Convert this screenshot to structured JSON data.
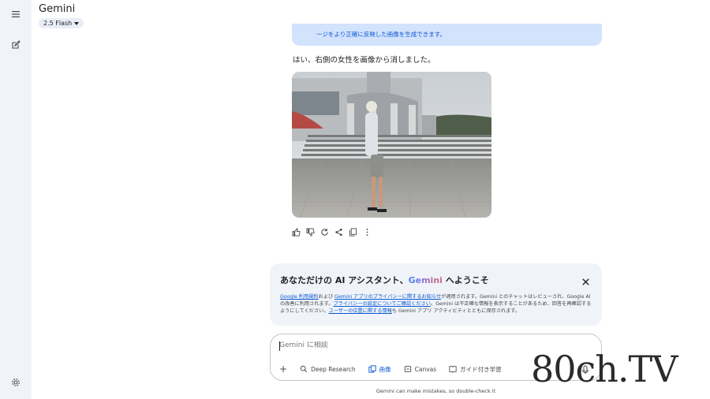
{
  "header": {
    "title": "Gemini",
    "model": "2.5 Flash"
  },
  "sidebar": {
    "menu_icon": "menu-icon",
    "new_chat_icon": "edit-icon",
    "settings_icon": "gear-icon"
  },
  "conversation": {
    "user_bubble_text": "ージをより正確に反映した画像を生成できます。",
    "reply_text": "はい、右側の女性を画像から消しました。",
    "action_icons": [
      "thumb-up-icon",
      "thumb-down-icon",
      "refresh-icon",
      "share-icon",
      "copy-icon",
      "more-icon"
    ]
  },
  "welcome": {
    "title_prefix": "あなただけの AI アシスタント、",
    "title_brand": "Gemini",
    "title_suffix": " へようこそ",
    "body": {
      "link1": "Google 利用規約",
      "t1": "および ",
      "link2": "Gemini アプリのプライバシーに関するお知らせ",
      "t2": "が適用されます。Gemini とのチャットはレビューされ、Google AI の改善に利用されます。",
      "link3": "プライバシーの設定についてご確認ください",
      "t3": "。Gemini は不正確な情報を表示することがあるため、回答を再確認するようにしてください。",
      "link4": "ユーザーの位置に関する情報",
      "t4": "も Gemini アプリ アクティビティとともに保存されます。"
    }
  },
  "composer": {
    "placeholder": "Gemini に相談",
    "tools": {
      "add": "+",
      "deep_research": "Deep Research",
      "image": "画像",
      "canvas": "Canvas",
      "guided": "ガイド付き学習"
    }
  },
  "disclaimer": "Gemini can make mistakes, so double-check it",
  "watermark": "80ch.TV",
  "colors": {
    "accent": "#0b57d0",
    "sidebar_bg": "#f0f4f9",
    "bubble_bg": "#d3e3fd"
  }
}
